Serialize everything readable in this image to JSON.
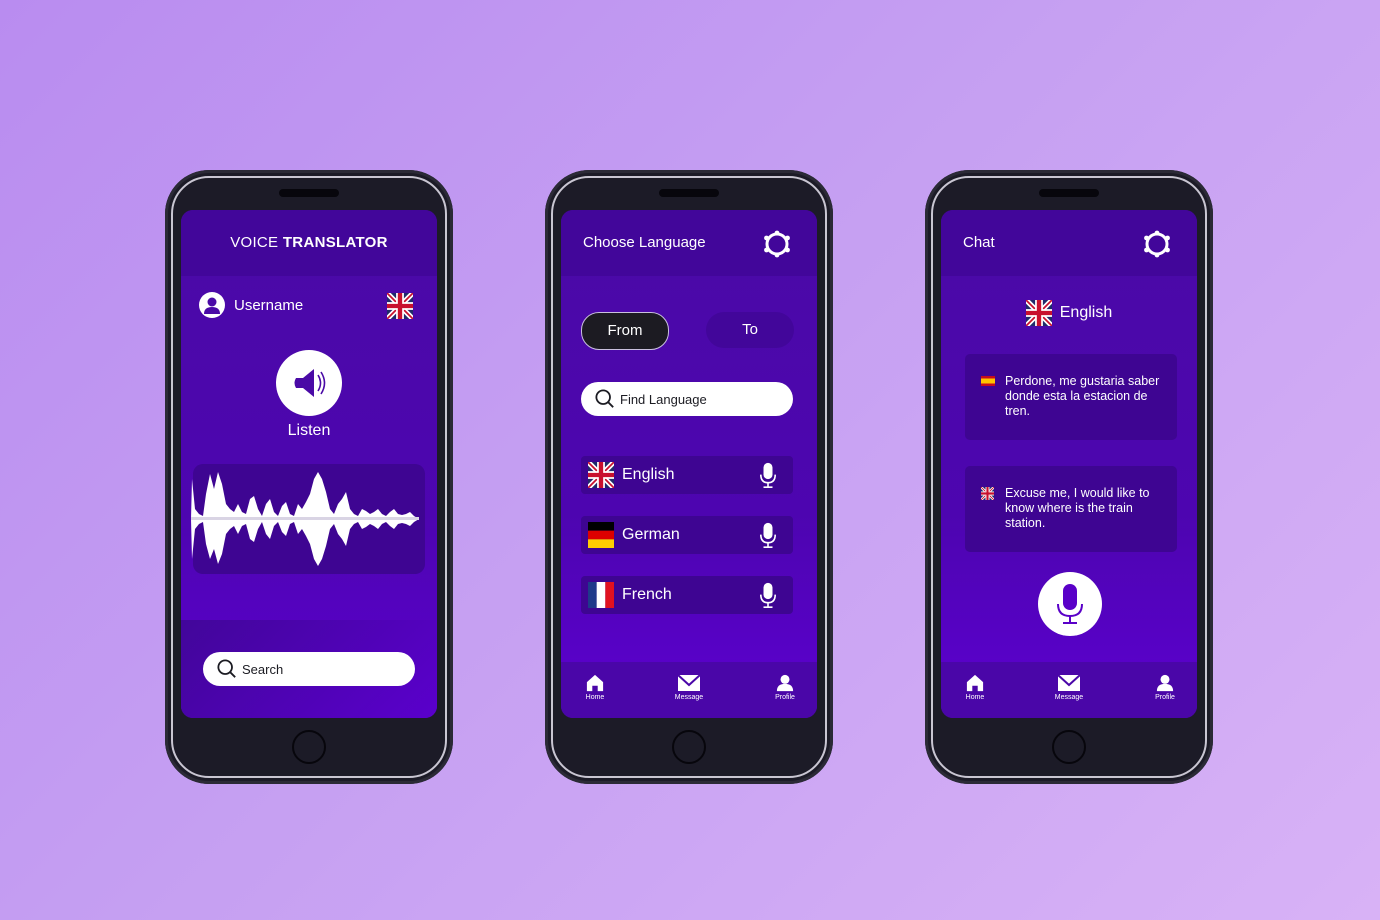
{
  "colors": {
    "background": "#c59ff2",
    "phone_body": "#1c1b27",
    "screen_purple": "#4d05b0",
    "header_purple": "#42069a",
    "card_purple": "#3e0592",
    "white": "#ffffff"
  },
  "phone1": {
    "title_light": "VOICE",
    "title_bold": "TRANSLATOR",
    "username": "Username",
    "user_icon": "user-avatar-icon",
    "flag_icon": "uk-flag-icon",
    "listen_icon": "speaker-icon",
    "listen_label": "Listen",
    "waveform_icon": "audio-waveform",
    "search_placeholder": "Search"
  },
  "phone2": {
    "title": "Choose Language",
    "settings_icon": "gear-icon",
    "tabs": [
      {
        "label": "From",
        "active": true
      },
      {
        "label": "To",
        "active": false
      }
    ],
    "search_placeholder": "Find Language",
    "languages": [
      {
        "label": "English",
        "flag": "uk-flag-icon",
        "mic": "microphone-icon"
      },
      {
        "label": "German",
        "flag": "germany-flag-icon",
        "mic": "microphone-icon"
      },
      {
        "label": "French",
        "flag": "france-flag-icon",
        "mic": "microphone-icon"
      }
    ],
    "nav": [
      {
        "label": "Home",
        "icon": "home-icon"
      },
      {
        "label": "Message",
        "icon": "envelope-icon"
      },
      {
        "label": "Profile",
        "icon": "profile-icon"
      }
    ]
  },
  "phone3": {
    "title": "Chat",
    "settings_icon": "gear-icon",
    "language": "English",
    "language_flag": "uk-flag-icon",
    "messages": [
      {
        "flag": "spain-flag-icon",
        "text": "Perdone, me gustaria saber donde esta la estacion de tren."
      },
      {
        "flag": "uk-flag-icon",
        "text": "Excuse me, I would like to know where is the train station."
      }
    ],
    "mic_icon": "microphone-icon",
    "nav": [
      {
        "label": "Home",
        "icon": "home-icon"
      },
      {
        "label": "Message",
        "icon": "envelope-icon"
      },
      {
        "label": "Profile",
        "icon": "profile-icon"
      }
    ]
  }
}
